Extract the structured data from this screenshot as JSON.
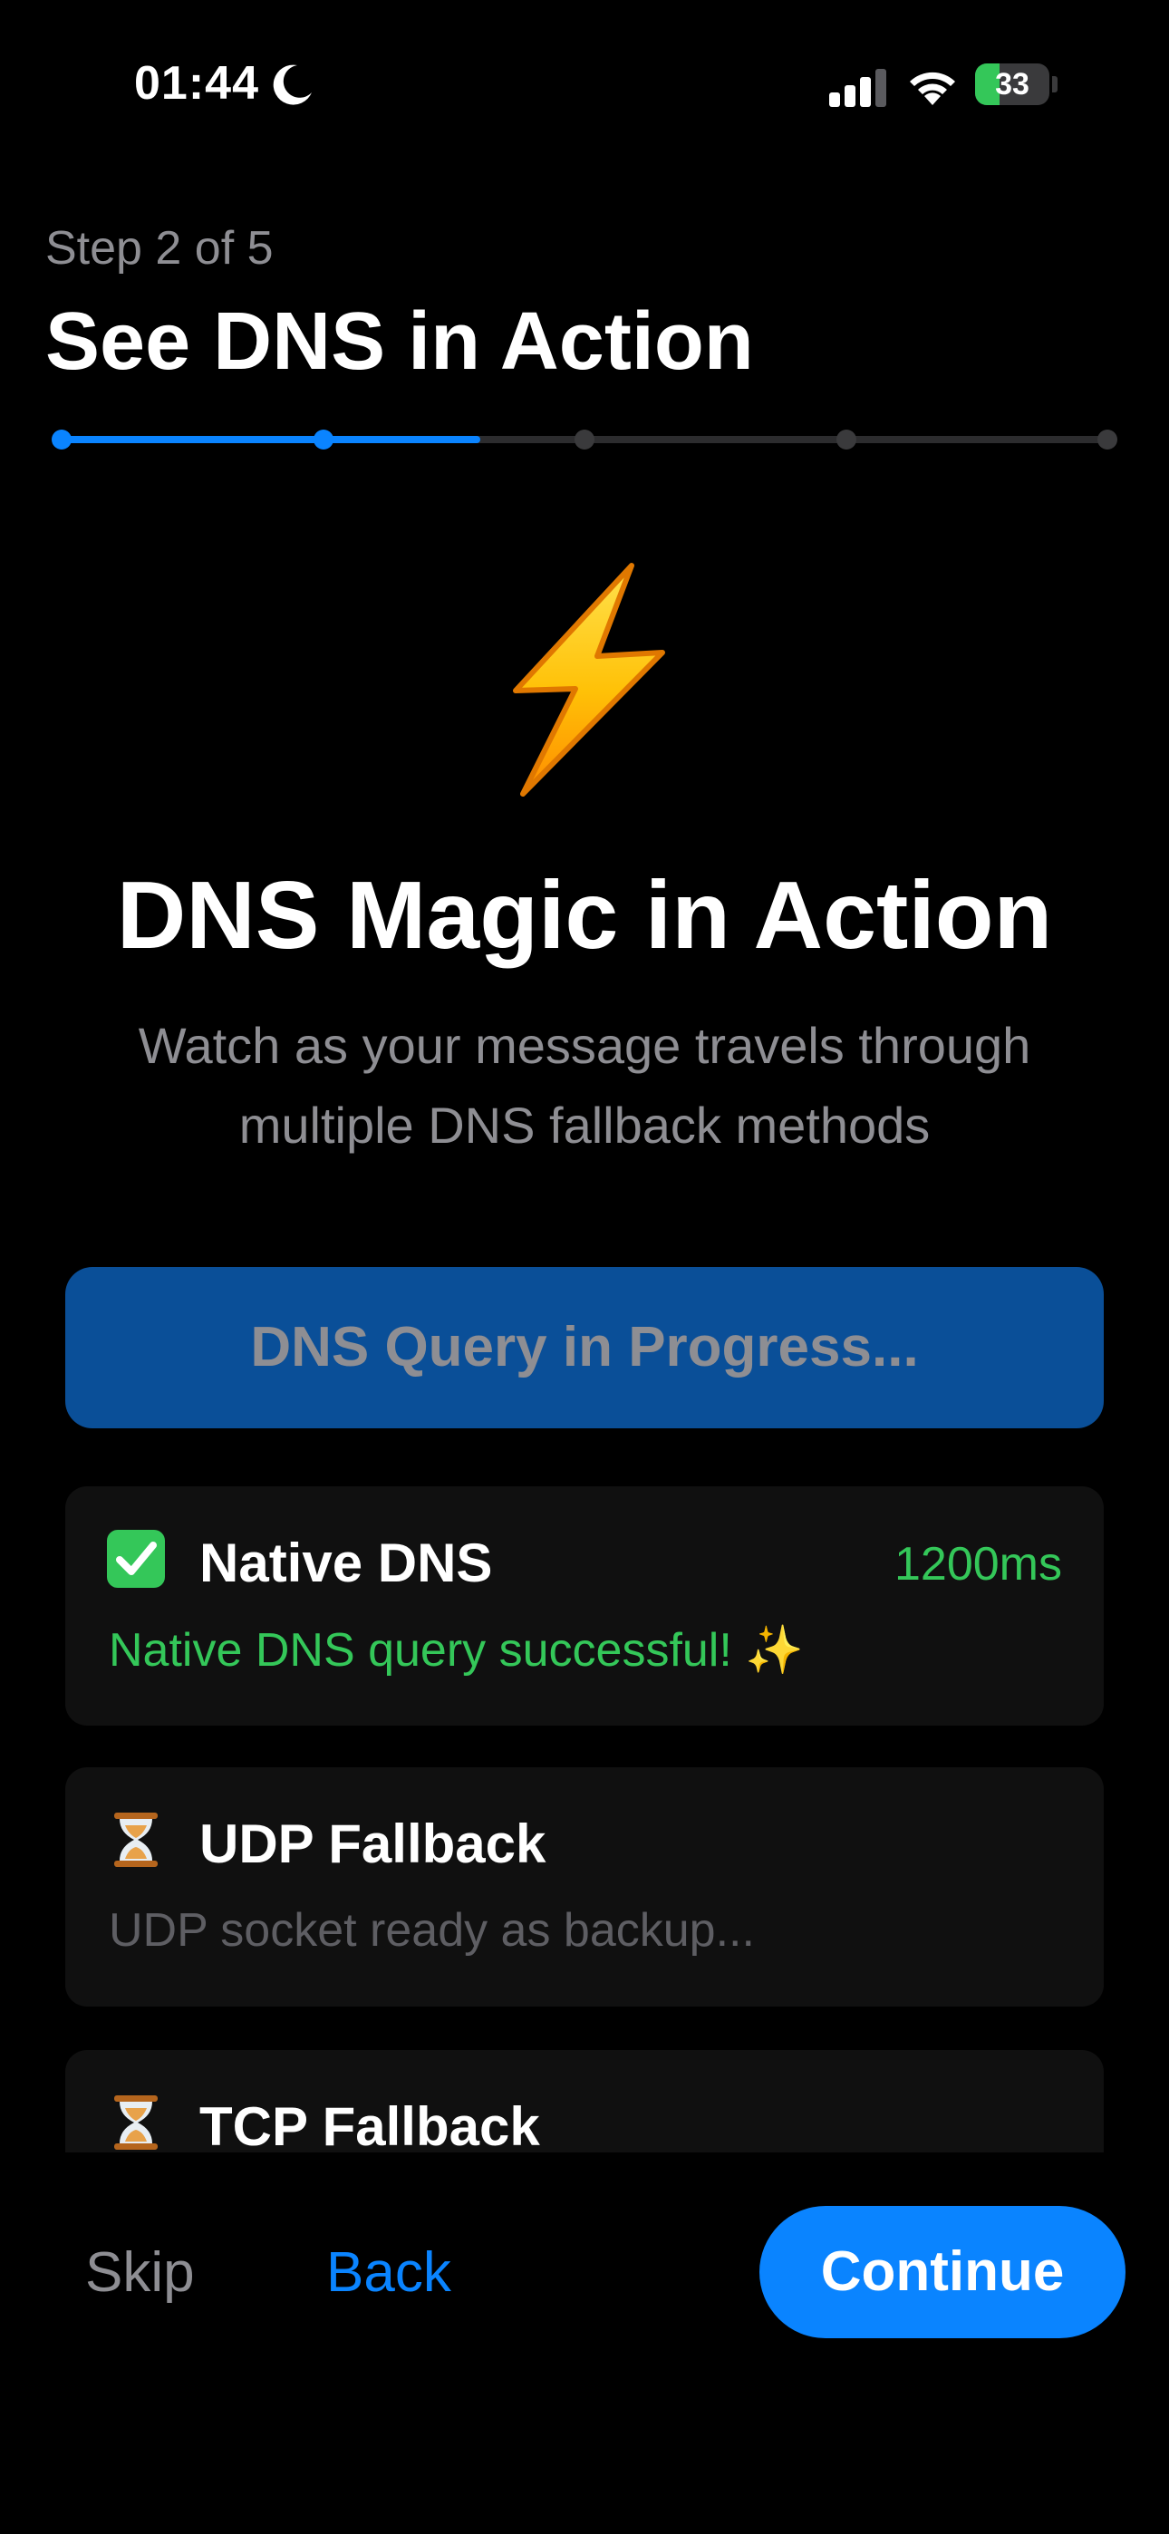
{
  "status_bar": {
    "time": "01:44",
    "battery_level": "33",
    "battery_fraction": 0.33,
    "icons": [
      "moon-icon",
      "cellular-signal-icon",
      "wifi-icon",
      "battery-charging-icon"
    ]
  },
  "header": {
    "step_label": "Step 2 of 5",
    "title": "See DNS in Action",
    "progress": {
      "current_step": 2,
      "total_steps": 5,
      "fraction": 0.4
    }
  },
  "hero": {
    "icon": "lightning-bolt-icon",
    "title": "DNS Magic in Action",
    "subtitle": "Watch as your message travels through multiple DNS fallback methods"
  },
  "query_button": {
    "label": "DNS Query in Progress..."
  },
  "methods": [
    {
      "icon": "check-mark-icon",
      "name": "Native DNS",
      "time": "1200ms",
      "detail": "Native DNS query successful! ✨",
      "status": "success"
    },
    {
      "icon": "hourglass-icon",
      "name": "UDP Fallback",
      "time": "",
      "detail": "UDP socket ready as backup...",
      "status": "pending"
    },
    {
      "icon": "hourglass-icon",
      "name": "TCP Fallback",
      "time": "",
      "detail": "",
      "status": "pending"
    }
  ],
  "footer": {
    "skip_label": "Skip",
    "back_label": "Back",
    "continue_label": "Continue"
  },
  "colors": {
    "accent": "#0a84ff",
    "success": "#34c759",
    "background": "#000000",
    "card": "#101010",
    "secondary_text": "#8e8e93"
  }
}
